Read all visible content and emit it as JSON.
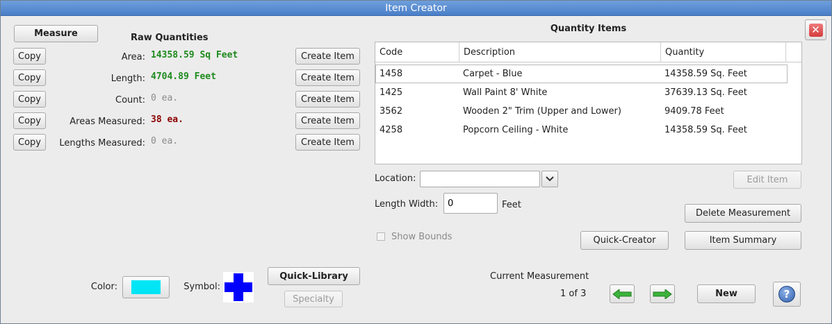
{
  "window": {
    "title": "Item Creator"
  },
  "left": {
    "measure_button": "Measure",
    "raw_title": "Raw Quantities",
    "copy_label": "Copy",
    "create_label": "Create Item",
    "rows": [
      {
        "label": "Area:",
        "value": "14358.59 Sq Feet",
        "style": "green"
      },
      {
        "label": "Length:",
        "value": "4704.89 Feet",
        "style": "green"
      },
      {
        "label": "Count:",
        "value": "0 ea.",
        "style": "gray"
      },
      {
        "label": "Areas Measured:",
        "value": "38 ea.",
        "style": "red"
      },
      {
        "label": "Lengths Measured:",
        "value": "0 ea.",
        "style": "gray"
      }
    ],
    "color_label": "Color:",
    "color_value": "#00e5f5",
    "symbol_label": "Symbol:",
    "symbol_color": "#0000ff",
    "quick_library": "Quick-Library",
    "specialty": "Specialty"
  },
  "right": {
    "items_title": "Quantity Items",
    "columns": [
      "Code",
      "Description",
      "Quantity"
    ],
    "rows": [
      {
        "code": "1458",
        "desc": "Carpet - Blue",
        "qty": "14358.59 Sq. Feet"
      },
      {
        "code": "1425",
        "desc": "Wall Paint 8' White",
        "qty": "37639.13 Sq. Feet"
      },
      {
        "code": "3562",
        "desc": "Wooden 2\" Trim (Upper and Lower)",
        "qty": "9409.78 Feet"
      },
      {
        "code": "4258",
        "desc": "Popcorn Ceiling - White",
        "qty": "14358.59 Sq. Feet"
      }
    ],
    "location_label": "Location:",
    "location_value": "",
    "edit_item": "Edit Item",
    "length_width_label": "Length Width:",
    "length_width_value": "0",
    "length_unit": "Feet",
    "delete_measurement": "Delete Measurement",
    "show_bounds": "Show Bounds",
    "quick_creator": "Quick-Creator",
    "item_summary": "Item Summary",
    "current_measurement_label": "Current Measurement",
    "measurement_index": "1 of 3",
    "new_button": "New",
    "help_icon": "?"
  },
  "colors": {
    "titlebar": "#5a8fd6",
    "close_button": "#e05050",
    "arrow_green": "#3cb43c"
  }
}
